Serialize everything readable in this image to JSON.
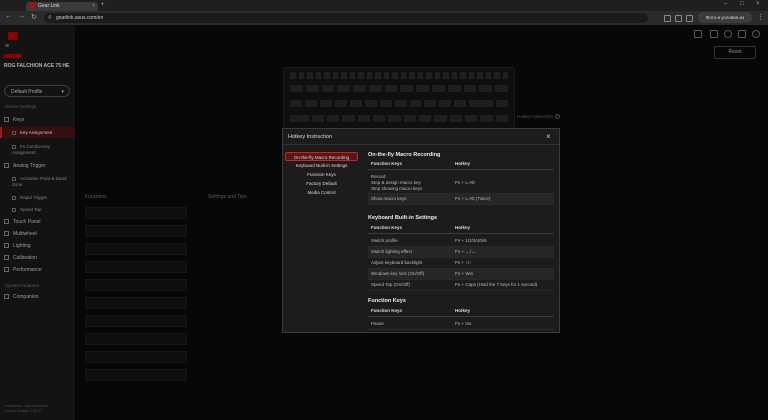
{
  "browser": {
    "tab_title": "Gear Link",
    "url": "gearlink.asus.com/en",
    "update_label": "Фото и условия из магазина"
  },
  "sidebar": {
    "device_name": "ROG FALCHION ACE 75 HE",
    "profile": "Default Profile",
    "device_settings_label": "Device Settings",
    "items": [
      {
        "label": "Keys"
      },
      {
        "label": "Key Assignment"
      },
      {
        "label": "Fn Combo Key Assignment"
      },
      {
        "label": "Analog Trigger"
      },
      {
        "label": "Actuation Point & Dead Zone"
      },
      {
        "label": "Rapid Trigger"
      },
      {
        "label": "Speed Tap"
      },
      {
        "label": "Touch Panel"
      },
      {
        "label": "Multiwheel"
      },
      {
        "label": "Lighting"
      },
      {
        "label": "Calibration"
      },
      {
        "label": "Performance"
      }
    ],
    "system_features_label": "System Features",
    "companion": "Companion",
    "footer_line1": "Companion · Not connected",
    "footer_line2": "Current Version: 1.00.17"
  },
  "main": {
    "reset": "Reset",
    "hotkey_instruction": "Hotkey Instruction",
    "functions_label": "Functions",
    "settings_label": "Settings and Tips"
  },
  "modal": {
    "title": "Hotkey Instruction",
    "nav": [
      "On-the-fly Macro Recording",
      "Keyboard Built-in Settings",
      "Function Keys",
      "Factory Default",
      "Media Control"
    ],
    "col_function": "Function Keys",
    "col_hotkey": "Hotkey",
    "sections": [
      {
        "heading": "On-the-fly Macro Recording",
        "rows": [
          {
            "fn": [
              "Record",
              "Stop & assign macro key",
              "Stop showing macro keys"
            ],
            "hk": "Fn + L-Alt"
          },
          {
            "fn": [
              "Show macro keys"
            ],
            "hk": "Fn + L-Alt (Twice)"
          }
        ]
      },
      {
        "heading": "Keyboard Built-in Settings",
        "rows": [
          {
            "fn": [
              "Switch profile"
            ],
            "hk": "Fn + 1/2/3/4/5/6"
          },
          {
            "fn": [
              "Switch lighting effect"
            ],
            "hk": "Fn + ←/→"
          },
          {
            "fn": [
              "Adjust keyboard backlight"
            ],
            "hk": "Fn + ↑/↓"
          },
          {
            "fn": [
              "Windows key lock (On/Off)"
            ],
            "hk": "Fn + Win"
          },
          {
            "fn": [
              "Speed Tap (On/Off)"
            ],
            "hk": "Fn + Caps (Hold the T keys for 1 second)"
          }
        ]
      },
      {
        "heading": "Function Keys",
        "rows": [
          {
            "fn": [
              "Pause"
            ],
            "hk": "Fn + Ins"
          }
        ]
      }
    ]
  }
}
